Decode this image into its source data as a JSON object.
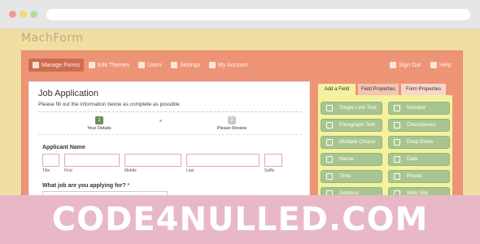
{
  "app": {
    "logo": "MachForm"
  },
  "topnav": {
    "manage_forms": "Manage Forms",
    "edit_themes": "Edit Themes",
    "users": "Users",
    "settings": "Settings",
    "my_account": "My Account",
    "sign_out": "Sign Out",
    "help": "Help"
  },
  "form": {
    "title": "Job Application",
    "description": "Please fill out the information below as complete as possible.",
    "steps": [
      {
        "number": "1",
        "label": "Your Details"
      },
      {
        "number": "2",
        "label": "Please Review"
      }
    ],
    "applicant_name": {
      "label": "Applicant Name",
      "sublabels": [
        "Title",
        "First",
        "Middle",
        "Last",
        "Suffix"
      ]
    },
    "job_question": {
      "label": "What job are you applying for?",
      "required_mark": "*"
    }
  },
  "sidebar": {
    "tabs": [
      "Add a Field",
      "Field Properties",
      "Form Properties"
    ],
    "fields": [
      [
        "Single Line Text",
        "Number"
      ],
      [
        "Paragraph Text",
        "Checkboxes"
      ],
      [
        "Multiple Choice",
        "Drop Down"
      ],
      [
        "Name",
        "Date"
      ],
      [
        "Time",
        "Phone"
      ],
      [
        "Address",
        "Web Site"
      ]
    ]
  },
  "watermark": {
    "text": "CODE4NULLED.COM"
  },
  "colors": {
    "panel": "#ee9476",
    "field_button": "#a9c58f",
    "step_active": "#6a8f5a",
    "watermark_band": "#e8b8c6"
  }
}
